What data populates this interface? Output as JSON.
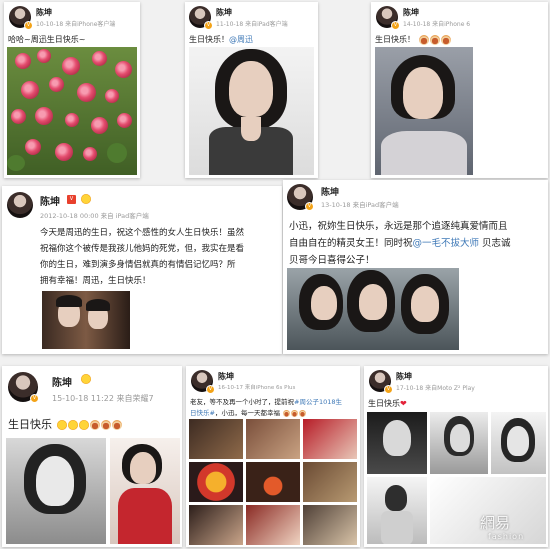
{
  "posts": [
    {
      "user": "陈坤",
      "meta": "10-10-18 来自iPhone客户端",
      "text": "哈哈~周迅生日快乐~"
    },
    {
      "user": "陈坤",
      "meta": "11-10-18 来自iPad客户端",
      "text_prefix": "生日快乐！",
      "mention": "@周迅"
    },
    {
      "user": "陈坤",
      "meta": "14-10-18 来自iPhone 6",
      "text": "生日快乐！"
    },
    {
      "user": "陈坤",
      "meta": "2012-10-18 00:00 来自 iPad客户端",
      "lines": [
        "今天是周迅的生日，祝这个感性的女人生日快乐！虽然",
        "祝福你这个被传是我孩儿他妈的死党，但，我实在是看",
        "你的生日，难到演多身情侣就真的有情侣记忆吗？所",
        "拥有幸福！周迅，生日快乐！"
      ]
    },
    {
      "user": "陈坤",
      "meta": "13-10-18 来自iPad客户端",
      "line1": "小迅，祝妳生日快乐，永远是那个追逐纯真爱情而且",
      "line2_prefix": "自由自在的精灵女王！同时祝",
      "line2_mention": "@一毛不拔大师",
      "line2_suffix": " 贝志诚",
      "line3": "贝哥今日喜得公子！"
    },
    {
      "user": "陈坤",
      "meta": "15-10-18 11:22  来自荣耀7",
      "text": "生日快乐"
    },
    {
      "user": "陈坤",
      "meta": "16-10-17 来自iPhone 6s Plus",
      "line1_prefix": "老友，等不及再一个小时了，提前祝",
      "line1_mention": "#周公子1018生",
      "line2_mention": "日快乐#",
      "line2_suffix": "，小迅，每一天都幸福"
    },
    {
      "user": "陈坤",
      "meta": "17-10-18 来自Moto Z² Play",
      "text": "生日快乐"
    }
  ],
  "watermark": {
    "cn": "網易",
    "en": "fashion"
  },
  "colors": {
    "mention": "#3f79b7",
    "meta": "#9a9a9a",
    "heart": "#e3233a"
  }
}
